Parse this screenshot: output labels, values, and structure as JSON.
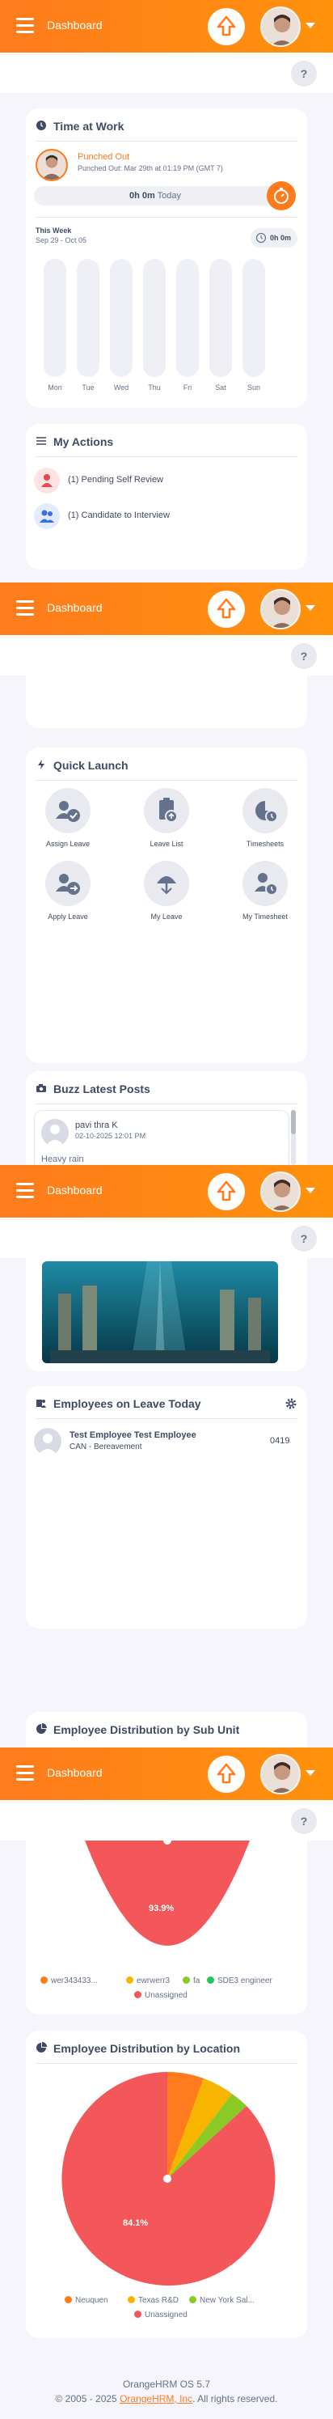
{
  "header": {
    "title": "Dashboard"
  },
  "help": {
    "label": "?"
  },
  "time_at_work": {
    "title": "Time at Work",
    "status": "Punched Out",
    "punched_out_detail": "Punched Out: Mar 29th at 01:19 PM (GMT 7)",
    "today_hours": "0h 0m",
    "today_label": "Today",
    "this_week_label": "This Week",
    "week_range": "Sep 29 - Oct 05",
    "week_total": "0h 0m",
    "days": [
      "Mon",
      "Tue",
      "Wed",
      "Thu",
      "Fri",
      "Sat",
      "Sun"
    ]
  },
  "my_actions": {
    "title": "My Actions",
    "items": [
      {
        "label": "(1) Pending Self Review",
        "icon": "person-icon",
        "color": "#ffe3e3"
      },
      {
        "label": "(1) Candidate to Interview",
        "icon": "people-icon",
        "color": "#e3ebff"
      }
    ]
  },
  "quick_launch": {
    "title": "Quick Launch",
    "items": [
      {
        "label": "Assign Leave",
        "icon": "assign-leave-icon"
      },
      {
        "label": "Leave List",
        "icon": "leave-list-icon"
      },
      {
        "label": "Timesheets",
        "icon": "timesheets-icon"
      },
      {
        "label": "Apply Leave",
        "icon": "apply-leave-icon"
      },
      {
        "label": "My Leave",
        "icon": "my-leave-icon"
      },
      {
        "label": "My Timesheet",
        "icon": "my-timesheet-icon"
      }
    ]
  },
  "buzz": {
    "title": "Buzz Latest Posts",
    "post_author": "pavi thra K",
    "post_time": "02-10-2025 12:01 PM",
    "post_text": "Heavy rain"
  },
  "employees_on_leave": {
    "title": "Employees on Leave Today",
    "employee_name": "Test Employee Test Employee",
    "leave_type": "CAN - Bereavement",
    "count": "0419"
  },
  "dist_sub_unit": {
    "title": "Employee Distribution by Sub Unit",
    "percent_label": "93.9%",
    "legend": [
      {
        "label": "wer343433...",
        "color": "#ff7b1d"
      },
      {
        "label": "ewrwerr3",
        "color": "#f7b500"
      },
      {
        "label": "fa",
        "color": "#8ac926"
      },
      {
        "label": "SDE3 engineer",
        "color": "#22c55e"
      },
      {
        "label": "Unassigned",
        "color": "#f4575a"
      }
    ]
  },
  "dist_location": {
    "title": "Employee Distribution by Location",
    "percent_label": "84.1%",
    "legend": [
      {
        "label": "Neuquen",
        "color": "#ff7b1d"
      },
      {
        "label": "Texas R&D",
        "color": "#f7b500"
      },
      {
        "label": "New York Sal...",
        "color": "#8ac926"
      },
      {
        "label": "Unassigned",
        "color": "#f4575a"
      }
    ]
  },
  "footer": {
    "version": "OrangeHRM OS 5.7",
    "copyright_prefix": "© 2005 - 2025",
    "company_link": "OrangeHRM, Inc",
    "copyright_suffix": ". All rights reserved."
  }
}
